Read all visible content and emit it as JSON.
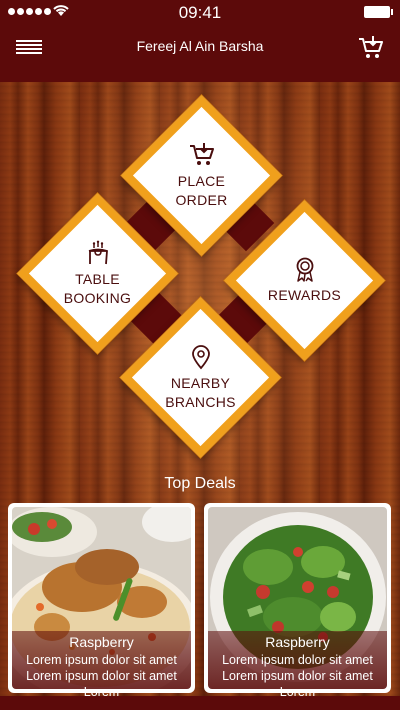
{
  "status_bar": {
    "time": "09:41"
  },
  "nav": {
    "title": "Fereej Al Ain Barsha",
    "menu_icon": "hamburger-menu-icon",
    "cart_icon": "cart-icon"
  },
  "menu_tiles": [
    {
      "id": "place-order",
      "line1": "PLACE",
      "line2": "ORDER",
      "icon": "cart-icon"
    },
    {
      "id": "table-booking",
      "line1": "TABLE",
      "line2": "BOOKING",
      "icon": "table-icon"
    },
    {
      "id": "rewards",
      "line1": "REWARDS",
      "line2": "",
      "icon": "award-ribbon-icon"
    },
    {
      "id": "nearby-branchs",
      "line1": "NEARBY",
      "line2": "BRANCHS",
      "icon": "location-pin-icon"
    }
  ],
  "section_title": "Top Deals",
  "deals": [
    {
      "name": "Raspberry",
      "description": "Lorem ipsum dolor sit amet Lorem ipsum dolor sit amet Lorem"
    },
    {
      "name": "Raspberry",
      "description": "Lorem ipsum dolor sit amet Lorem ipsum dolor sit amet Lorem"
    }
  ],
  "colors": {
    "brand": "#5c0a0a",
    "accent": "#f0a01c",
    "tile_bg": "#ffffff"
  }
}
